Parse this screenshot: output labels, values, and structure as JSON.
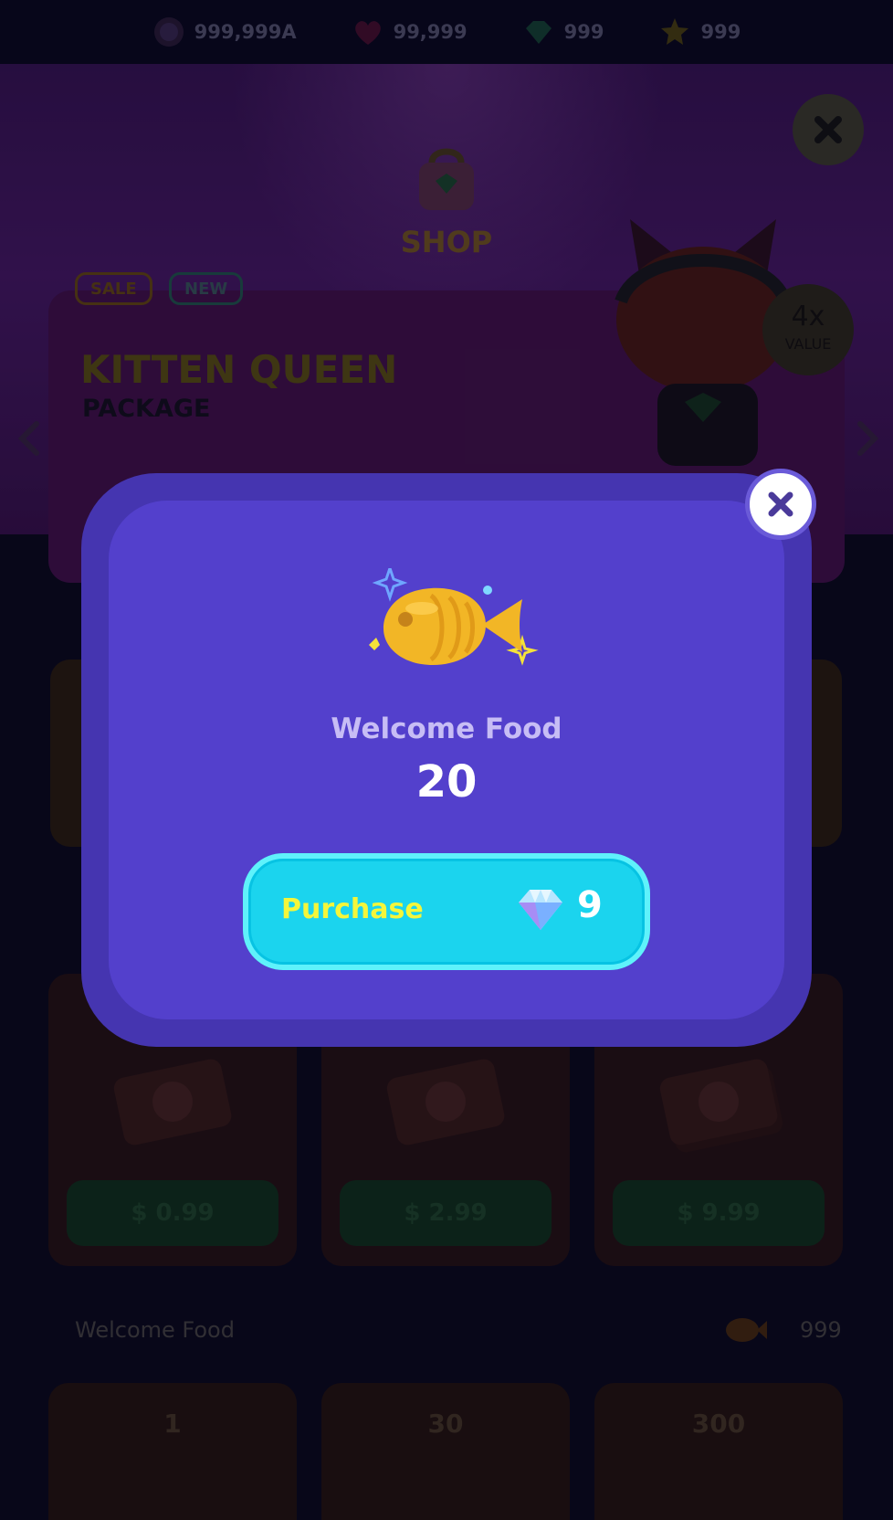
{
  "resources": [
    {
      "icon": "coin-icon",
      "value": "999,999A"
    },
    {
      "icon": "heart-icon",
      "value": "99,999"
    },
    {
      "icon": "gem-icon",
      "value": "999"
    },
    {
      "icon": "star-icon",
      "value": "999"
    }
  ],
  "shop": {
    "title": "SHOP",
    "tags": {
      "sale": "SALE",
      "new": "NEW"
    },
    "package": {
      "title": "KITTEN QUEEN",
      "subtitle": "PACKAGE",
      "badge_value": "4x",
      "badge_label": "VALUE"
    }
  },
  "tickets": {
    "prices": [
      "$ 0.99",
      "$ 2.99",
      "$ 9.99"
    ]
  },
  "food_section": {
    "label": "Welcome Food",
    "count": "999",
    "quantities": [
      "1",
      "30",
      "300"
    ]
  },
  "modal": {
    "item_name": "Welcome Food",
    "quantity": "20",
    "purchase_label": "Purchase",
    "price": "9",
    "price_icon": "diamond-icon"
  },
  "colors": {
    "modal_bg": "#5340cc",
    "modal_border": "#4535b0",
    "button_bg": "#1bd4ee",
    "button_text": "#f4f63a"
  }
}
